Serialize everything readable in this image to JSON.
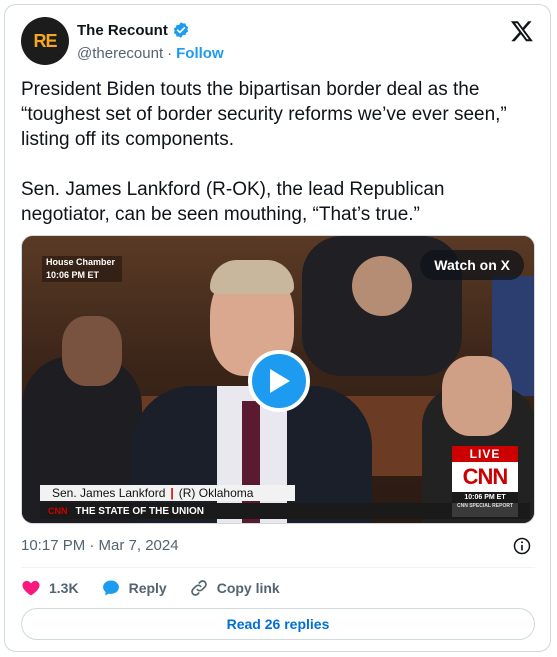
{
  "author": {
    "display_name": "The Recount",
    "handle": "@therecount",
    "follow_label": "Follow",
    "avatar_text": "RE"
  },
  "tweet": {
    "text": "President Biden touts the bipartisan border deal as the “toughest set of border security reforms we’ve ever seen,” listing off its components.\n\nSen. James Lankford (R-OK), the lead Republican negotiator, can be seen mouthing, “That’s true.”",
    "timestamp": "10:17 PM · Mar 7, 2024"
  },
  "video": {
    "watch_label": "Watch on X",
    "chyron_location": "House Chamber",
    "chyron_time": "10:06 PM ET",
    "lower_third_name": "Sen. James Lankford",
    "lower_third_party": "(R) Oklahoma",
    "ticker_brand": "CNN",
    "ticker_text": "THE STATE OF THE UNION",
    "live_label": "LIVE",
    "network_logo": "CNN",
    "network_time": "10:06 PM ET",
    "network_special": "CNN SPECIAL REPORT"
  },
  "actions": {
    "likes": "1.3K",
    "reply_label": "Reply",
    "copy_link_label": "Copy link",
    "read_replies_label": "Read 26 replies"
  },
  "colors": {
    "accent": "#1d9bf0",
    "like": "#f91880",
    "text_secondary": "#536471"
  }
}
